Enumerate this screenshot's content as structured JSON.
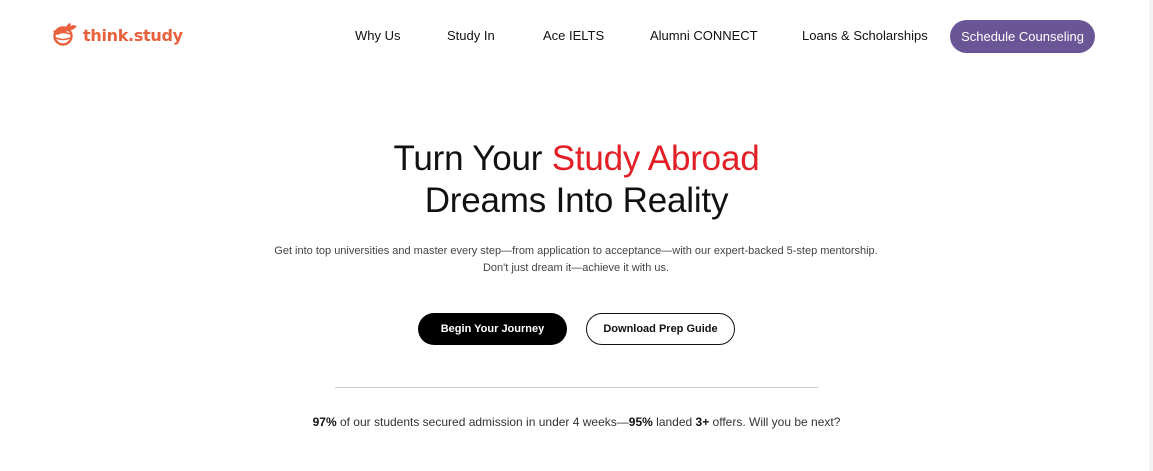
{
  "brand": {
    "name": "think.study",
    "color": "#e8613c",
    "icon": "airplane-globe-icon"
  },
  "nav": {
    "items": [
      {
        "label": "Why Us"
      },
      {
        "label": "Study In"
      },
      {
        "label": "Ace IELTS"
      },
      {
        "label": "Alumni CONNECT"
      },
      {
        "label": "Loans & Scholarships"
      }
    ],
    "cta_label": "Schedule Counseling",
    "cta_color": "#6a5596"
  },
  "hero": {
    "title_part1": "Turn Your ",
    "title_accent": "Study Abroad",
    "title_line2": "Dreams Into Reality",
    "accent_color": "#e31e24",
    "subtitle_line1": "Get into top universities and master every step—from application to acceptance—with our expert-backed 5-step mentorship.",
    "subtitle_line2": "Don't just dream it—achieve it with us.",
    "primary_button": "Begin Your Journey",
    "secondary_button": "Download Prep Guide"
  },
  "stats": {
    "pct1": "97%",
    "text1": " of our students secured admission in under 4 weeks—",
    "pct2": "95%",
    "text2": " landed ",
    "offers": "3+",
    "text3": " offers. Will you be next?"
  }
}
